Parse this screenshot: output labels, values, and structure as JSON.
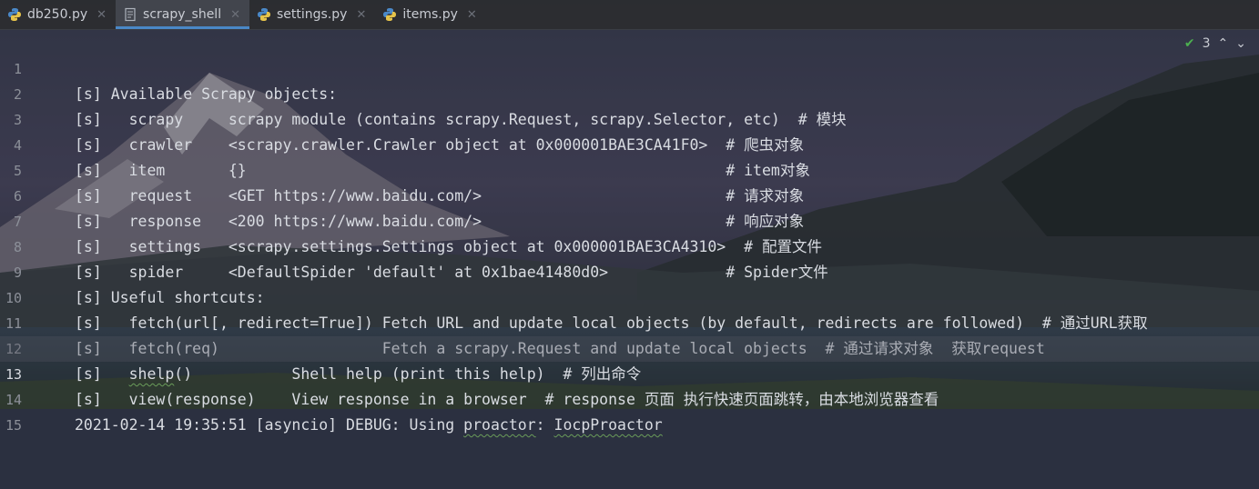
{
  "colors": {
    "tab_active_underline": "#4a88c7",
    "text": "#d9dce2",
    "line_number": "#8c9099",
    "check_green": "#4caf50"
  },
  "tabs": [
    {
      "label": "db250.py",
      "icon": "python-file-icon",
      "active": false
    },
    {
      "label": "scrapy_shell",
      "icon": "text-file-icon",
      "active": true
    },
    {
      "label": "settings.py",
      "icon": "python-file-icon",
      "active": false
    },
    {
      "label": "items.py",
      "icon": "python-file-icon",
      "active": false
    }
  ],
  "inspection": {
    "count": "3",
    "icon": "inspection-ok-icon"
  },
  "lines": [
    {
      "num": "1",
      "text": "[s] Available Scrapy objects:"
    },
    {
      "num": "2",
      "text": "[s]   scrapy     scrapy module (contains scrapy.Request, scrapy.Selector, etc)  # 模块"
    },
    {
      "num": "3",
      "text": "[s]   crawler    <scrapy.crawler.Crawler object at 0x000001BAE3CA41F0>  # 爬虫对象"
    },
    {
      "num": "4",
      "text": "[s]   item       {}                                                     # item对象"
    },
    {
      "num": "5",
      "text": "[s]   request    <GET https://www.baidu.com/>                           # 请求对象"
    },
    {
      "num": "6",
      "text": "[s]   response   <200 https://www.baidu.com/>                           # 响应对象"
    },
    {
      "num": "7",
      "text": "[s]   settings   <scrapy.settings.Settings object at 0x000001BAE3CA4310>  # 配置文件"
    },
    {
      "num": "8",
      "text": "[s]   spider     <DefaultSpider 'default' at 0x1bae41480d0>             # Spider文件"
    },
    {
      "num": "9",
      "text": "[s] Useful shortcuts:"
    },
    {
      "num": "10",
      "text": "[s]   fetch(url[, redirect=True]) Fetch URL and update local objects (by default, redirects are followed)  # 通过URL获取"
    },
    {
      "num": "11",
      "text": "[s]   fetch(req)                  Fetch a scrapy.Request and update local objects  # 通过请求对象  获取request"
    },
    {
      "num": "12",
      "text_pre": "[s]   ",
      "text_sq": "shelp",
      "text_post": "()           Shell help (print this help)  # 列出命令"
    },
    {
      "num": "13",
      "text": "[s]   view(response)    View response in a browser  # response 页面 执行快速页面跳转，由本地浏览器查看"
    },
    {
      "num": "14",
      "text_pre": "2021-02-14 19:35:51 [asyncio] DEBUG: Using ",
      "text_sq": "proactor",
      "text_mid": ": ",
      "text_sq2": "IocpProactor",
      "text_post": ""
    },
    {
      "num": "15",
      "text": ""
    }
  ],
  "current_line": "13"
}
